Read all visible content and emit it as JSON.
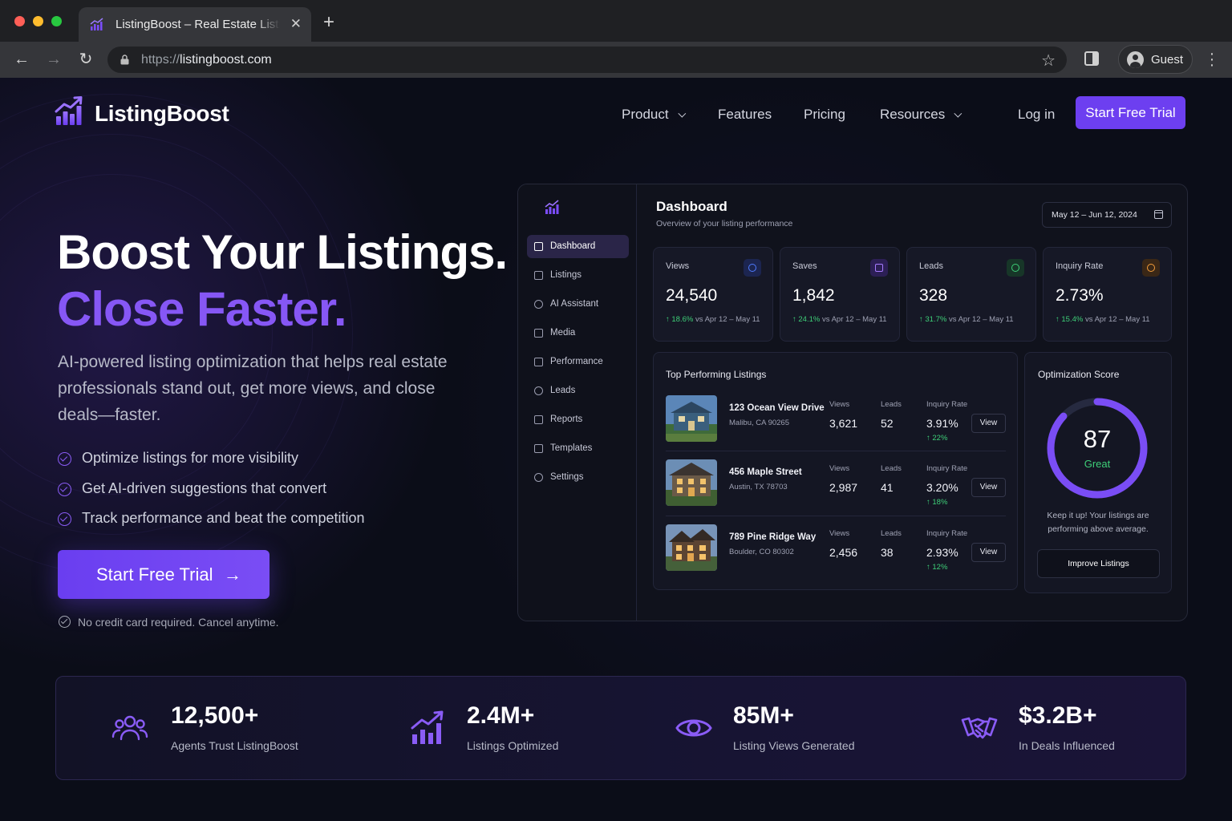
{
  "browser": {
    "tab_title": "ListingBoost – Real Estate Listing",
    "url_scheme": "https://",
    "url_host": "listingboost.com",
    "profile_name": "Guest"
  },
  "nav": {
    "brand": "ListingBoost",
    "items": [
      {
        "label": "Product",
        "dropdown": true
      },
      {
        "label": "Features",
        "dropdown": false
      },
      {
        "label": "Pricing",
        "dropdown": false
      },
      {
        "label": "Resources",
        "dropdown": true
      }
    ],
    "login": "Log in",
    "cta": "Start Free Trial"
  },
  "hero": {
    "line1": "Boost Your Listings.",
    "line2": "Close Faster.",
    "subtitle": "AI-powered listing optimization that helps real estate professionals stand out, get more views, and close deals—faster.",
    "bullets": [
      "Optimize listings for more visibility",
      "Get AI-driven suggestions that convert",
      "Track performance and beat the competition"
    ],
    "cta": "Start Free Trial",
    "note": "No credit card required. Cancel anytime."
  },
  "dashboard": {
    "title": "Dashboard",
    "subtitle": "Overview of your listing performance",
    "date_range": "May 12 – Jun 12, 2024",
    "sidebar": [
      "Dashboard",
      "Listings",
      "AI Assistant",
      "Media",
      "Performance",
      "Leads",
      "Reports",
      "Templates",
      "Settings"
    ],
    "active_item": "Dashboard",
    "kpis": [
      {
        "label": "Views",
        "value": "24,540",
        "delta": "18.6%",
        "compare": "vs Apr 12 – May 11",
        "color": "#4f7bff"
      },
      {
        "label": "Saves",
        "value": "1,842",
        "delta": "24.1%",
        "compare": "vs Apr 12 – May 11",
        "color": "#a77bff"
      },
      {
        "label": "Leads",
        "value": "328",
        "delta": "31.7%",
        "compare": "vs Apr 12 – May 11",
        "color": "#3ecf78"
      },
      {
        "label": "Inquiry Rate",
        "value": "2.73%",
        "delta": "15.4%",
        "compare": "vs Apr 12 – May 11",
        "color": "#f59e3b"
      }
    ],
    "top_listings": {
      "title": "Top Performing Listings",
      "col_views": "Views",
      "col_leads": "Leads",
      "col_inquiry": "Inquiry Rate",
      "view_label": "View",
      "rows": [
        {
          "address": "123 Ocean View Drive",
          "city": "Malibu, CA 90265",
          "views": "3,621",
          "leads": "52",
          "inquiry": "3.91%",
          "change": "22%"
        },
        {
          "address": "456 Maple Street",
          "city": "Austin, TX 78703",
          "views": "2,987",
          "leads": "41",
          "inquiry": "3.20%",
          "change": "18%"
        },
        {
          "address": "789 Pine Ridge Way",
          "city": "Boulder, CO 80302",
          "views": "2,456",
          "leads": "38",
          "inquiry": "2.93%",
          "change": "12%"
        }
      ]
    },
    "optimization": {
      "title": "Optimization Score",
      "score": "87",
      "score_fraction": 0.87,
      "label": "Great",
      "note": "Keep it up! Your listings are performing above average.",
      "button": "Improve Listings"
    }
  },
  "stats": [
    {
      "value": "12,500+",
      "label": "Agents Trust ListingBoost",
      "icon": "users-icon"
    },
    {
      "value": "2.4M+",
      "label": "Listings Optimized",
      "icon": "growth-chart-icon"
    },
    {
      "value": "85M+",
      "label": "Listing Views Generated",
      "icon": "eye-icon"
    },
    {
      "value": "$3.2B+",
      "label": "In Deals Influenced",
      "icon": "handshake-icon"
    }
  ],
  "colors": {
    "accent": "#6d3ff0",
    "accent_text": "#8657f5",
    "positive": "#3ecf78",
    "background": "#0b0d18"
  }
}
